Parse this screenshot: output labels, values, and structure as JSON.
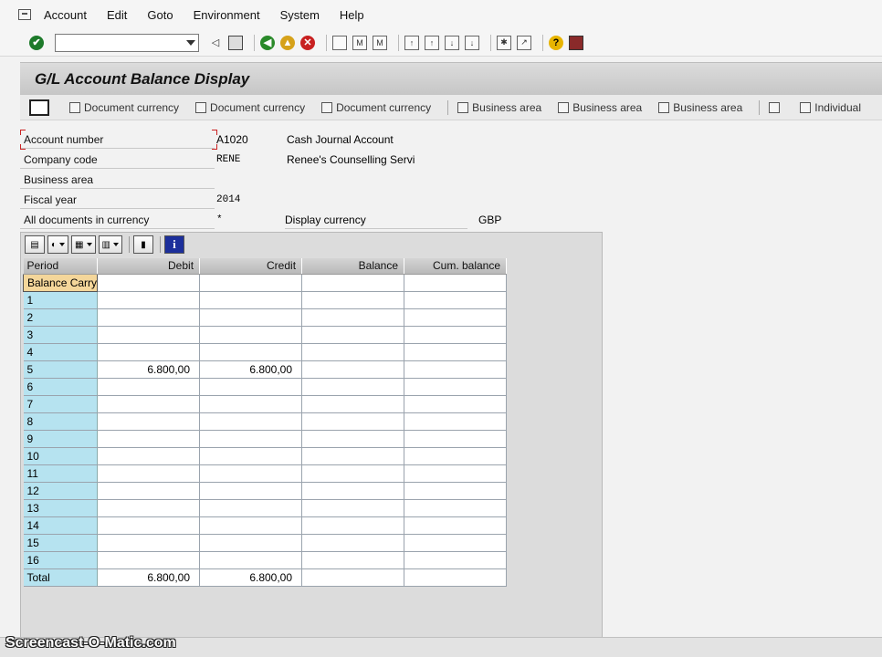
{
  "menu": {
    "items": [
      "Account",
      "Edit",
      "Goto",
      "Environment",
      "System",
      "Help"
    ]
  },
  "toolbar": {
    "command_value": "",
    "icons": [
      "enter-icon",
      "command-field",
      "back-icon",
      "exit-icon",
      "cancel-icon",
      "print-icon",
      "find-icon",
      "find-next-icon",
      "first-page-icon",
      "previous-page-icon",
      "next-page-icon",
      "last-page-icon",
      "new-session-icon",
      "shortcut-icon",
      "help-icon",
      "customize-layout-icon"
    ]
  },
  "title": "G/L Account Balance Display",
  "app_toolbar": {
    "buttons": [
      "Document currency",
      "Document currency",
      "Document currency",
      "Business area",
      "Business area",
      "Business area",
      "Individual"
    ]
  },
  "header": {
    "account_number": {
      "label": "Account number",
      "value": "A1020",
      "description": "Cash Journal Account"
    },
    "company_code": {
      "label": "Company code",
      "value": "RENE",
      "description": "Renee's Counselling Servi"
    },
    "business_area": {
      "label": "Business area",
      "value": ""
    },
    "fiscal_year": {
      "label": "Fiscal year",
      "value": "2014"
    },
    "all_docs": {
      "label": "All documents in currency",
      "value": "*"
    },
    "display_currency": {
      "label": "Display currency",
      "value": "GBP"
    }
  },
  "grid": {
    "columns": [
      "Period",
      "Debit",
      "Credit",
      "Balance",
      "Cum. balance"
    ],
    "rows": [
      [
        "Balance Carry",
        "",
        "",
        "",
        ""
      ],
      [
        "1",
        "",
        "",
        "",
        ""
      ],
      [
        "2",
        "",
        "",
        "",
        ""
      ],
      [
        "3",
        "",
        "",
        "",
        ""
      ],
      [
        "4",
        "",
        "",
        "",
        ""
      ],
      [
        "5",
        "6.800,00",
        "6.800,00",
        "",
        ""
      ],
      [
        "6",
        "",
        "",
        "",
        ""
      ],
      [
        "7",
        "",
        "",
        "",
        ""
      ],
      [
        "8",
        "",
        "",
        "",
        ""
      ],
      [
        "9",
        "",
        "",
        "",
        ""
      ],
      [
        "10",
        "",
        "",
        "",
        ""
      ],
      [
        "11",
        "",
        "",
        "",
        ""
      ],
      [
        "12",
        "",
        "",
        "",
        ""
      ],
      [
        "13",
        "",
        "",
        "",
        ""
      ],
      [
        "14",
        "",
        "",
        "",
        ""
      ],
      [
        "15",
        "",
        "",
        "",
        ""
      ],
      [
        "16",
        "",
        "",
        "",
        ""
      ],
      [
        "Total",
        "6.800,00",
        "6.800,00",
        "",
        ""
      ]
    ]
  },
  "watermark": "Screencast-O-Matic.com"
}
